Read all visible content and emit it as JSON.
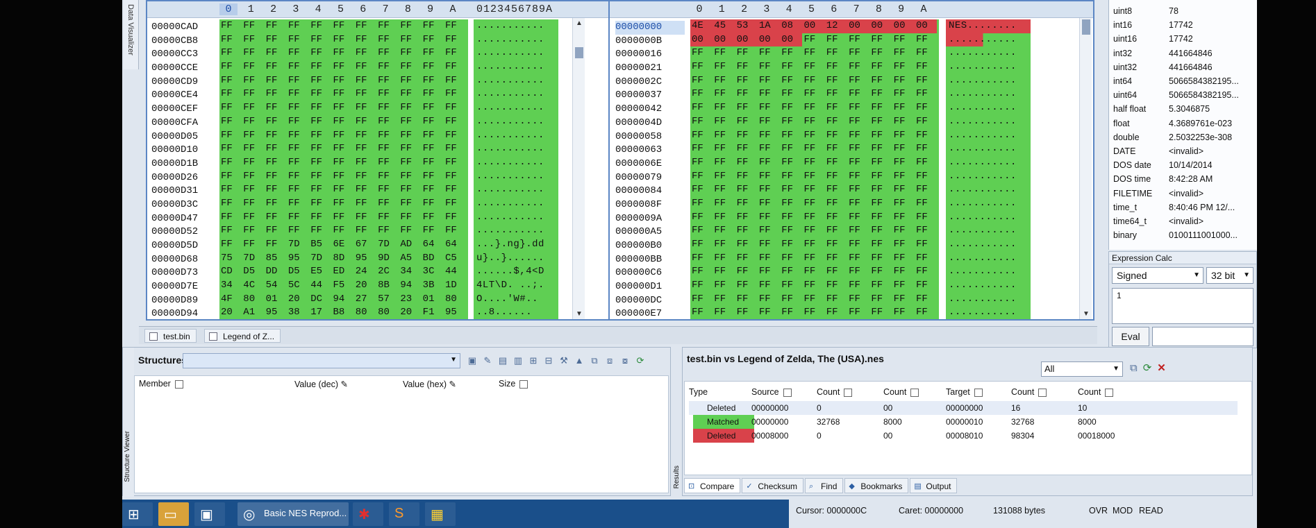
{
  "sidebar": {
    "data_visualizer_label": "Data Visualizer"
  },
  "left_pane": {
    "columns": [
      "0",
      "1",
      "2",
      "3",
      "4",
      "5",
      "6",
      "7",
      "8",
      "9",
      "A"
    ],
    "ascii_header": "0123456789A",
    "offsets": [
      "00000CAD",
      "00000CB8",
      "00000CC3",
      "00000CCE",
      "00000CD9",
      "00000CE4",
      "00000CEF",
      "00000CFA",
      "00000D05",
      "00000D10",
      "00000D1B",
      "00000D26",
      "00000D31",
      "00000D3C",
      "00000D47",
      "00000D52",
      "00000D5D",
      "00000D68",
      "00000D73",
      "00000D7E",
      "00000D89",
      "00000D94"
    ],
    "rows": [
      "FF FF FF FF FF FF FF FF FF FF FF",
      "FF FF FF FF FF FF FF FF FF FF FF",
      "FF FF FF FF FF FF FF FF FF FF FF",
      "FF FF FF FF FF FF FF FF FF FF FF",
      "FF FF FF FF FF FF FF FF FF FF FF",
      "FF FF FF FF FF FF FF FF FF FF FF",
      "FF FF FF FF FF FF FF FF FF FF FF",
      "FF FF FF FF FF FF FF FF FF FF FF",
      "FF FF FF FF FF FF FF FF FF FF FF",
      "FF FF FF FF FF FF FF FF FF FF FF",
      "FF FF FF FF FF FF FF FF FF FF FF",
      "FF FF FF FF FF FF FF FF FF FF FF",
      "FF FF FF FF FF FF FF FF FF FF FF",
      "FF FF FF FF FF FF FF FF FF FF FF",
      "FF FF FF FF FF FF FF FF FF FF FF",
      "FF FF FF FF FF FF FF FF FF FF FF",
      "FF FF FF 7D B5 6E 67 7D AD 64 64",
      "75 7D 85 95 7D 8D 95 9D A5 BD C5",
      "CD D5 DD D5 E5 ED 24 2C 34 3C 44",
      "34 4C 54 5C 44 F5 20 8B 94 3B 1D",
      "4F 80 01 20 DC 94 27 57 23 01 80",
      "20 A1 95 38 17 B8 80 80 20 F1 95"
    ],
    "ascii": [
      "...........",
      "...........",
      "...........",
      "...........",
      "...........",
      "...........",
      "...........",
      "...........",
      "...........",
      "...........",
      "...........",
      "...........",
      "...........",
      "...........",
      "...........",
      "...........",
      "...}.ng}.dd",
      "u}..}......",
      "......$,4<D",
      "4LT\\D. ..;.",
      "O....'W#..",
      "..8......"
    ]
  },
  "right_pane": {
    "columns": [
      "0",
      "1",
      "2",
      "3",
      "4",
      "5",
      "6",
      "7",
      "8",
      "9",
      "A"
    ],
    "offsets": [
      "00000000",
      "0000000B",
      "00000016",
      "00000021",
      "0000002C",
      "00000037",
      "00000042",
      "0000004D",
      "00000058",
      "00000063",
      "0000006E",
      "00000079",
      "00000084",
      "0000008F",
      "0000009A",
      "000000A5",
      "000000B0",
      "000000BB",
      "000000C6",
      "000000D1",
      "000000DC",
      "000000E7"
    ],
    "rows": [
      "4E 45 53 1A 08 00 12 00 00 00 00",
      "00 00 00 00 00 FF FF FF FF FF FF",
      "FF FF FF FF FF FF FF FF FF FF FF",
      "FF FF FF FF FF FF FF FF FF FF FF",
      "FF FF FF FF FF FF FF FF FF FF FF",
      "FF FF FF FF FF FF FF FF FF FF FF",
      "FF FF FF FF FF FF FF FF FF FF FF",
      "FF FF FF FF FF FF FF FF FF FF FF",
      "FF FF FF FF FF FF FF FF FF FF FF",
      "FF FF FF FF FF FF FF FF FF FF FF",
      "FF FF FF FF FF FF FF FF FF FF FF",
      "FF FF FF FF FF FF FF FF FF FF FF",
      "FF FF FF FF FF FF FF FF FF FF FF",
      "FF FF FF FF FF FF FF FF FF FF FF",
      "FF FF FF FF FF FF FF FF FF FF FF",
      "FF FF FF FF FF FF FF FF FF FF FF",
      "FF FF FF FF FF FF FF FF FF FF FF",
      "FF FF FF FF FF FF FF FF FF FF FF",
      "FF FF FF FF FF FF FF FF FF FF FF",
      "FF FF FF FF FF FF FF FF FF FF FF",
      "FF FF FF FF FF FF FF FF FF FF FF",
      "FF FF FF FF FF FF FF FF FF FF FF"
    ],
    "ascii": [
      "NES........",
      "...........",
      "...........",
      "...........",
      "...........",
      "...........",
      "...........",
      "...........",
      "...........",
      "...........",
      "...........",
      "...........",
      "...........",
      "...........",
      "...........",
      "...........",
      "...........",
      "...........",
      "...........",
      "...........",
      "...........",
      "..........."
    ]
  },
  "doc_tabs": [
    "test.bin",
    "Legend of Z..."
  ],
  "inspector": [
    {
      "k": "uint8",
      "v": "78"
    },
    {
      "k": "int16",
      "v": "17742"
    },
    {
      "k": "uint16",
      "v": "17742"
    },
    {
      "k": "int32",
      "v": "441664846"
    },
    {
      "k": "uint32",
      "v": "441664846"
    },
    {
      "k": "int64",
      "v": "5066584382195..."
    },
    {
      "k": "uint64",
      "v": "5066584382195..."
    },
    {
      "k": "half float",
      "v": "5.3046875"
    },
    {
      "k": "float",
      "v": "4.3689761e-023"
    },
    {
      "k": "double",
      "v": "2.5032253e-308"
    },
    {
      "k": "DATE",
      "v": "<invalid>"
    },
    {
      "k": "DOS date",
      "v": "10/14/2014"
    },
    {
      "k": "DOS time",
      "v": "8:42:28 AM"
    },
    {
      "k": "FILETIME",
      "v": "<invalid>"
    },
    {
      "k": "time_t",
      "v": "8:40:46 PM 12/..."
    },
    {
      "k": "time64_t",
      "v": "<invalid>"
    },
    {
      "k": "binary",
      "v": "0100111001000..."
    }
  ],
  "calc": {
    "title": "Expression Calc",
    "signed": "Signed",
    "bits": "32 bit",
    "expression": "1",
    "eval_label": "Eval"
  },
  "structures": {
    "title": "Structures",
    "side_label": "Structure Viewer",
    "headers": [
      "Member",
      "Value (dec)",
      "Value (hex)",
      "Size"
    ]
  },
  "compare": {
    "title": "test.bin vs Legend of Zelda, The (USA).nes",
    "side_label": "Results",
    "filter": "All",
    "headers": [
      "Type",
      "Source",
      "Count",
      "Count",
      "Target",
      "Count",
      "Count"
    ],
    "rows": [
      {
        "type": "Deleted",
        "source": "00000000",
        "count1": "0",
        "count2": "00",
        "target": "00000000",
        "count3": "16",
        "count4": "10",
        "color": ""
      },
      {
        "type": "Matched",
        "source": "00000000",
        "count1": "32768",
        "count2": "8000",
        "target": "00000010",
        "count3": "32768",
        "count4": "8000",
        "color": "#5fcf53"
      },
      {
        "type": "Deleted",
        "source": "00008000",
        "count1": "0",
        "count2": "00",
        "target": "00008010",
        "count3": "98304",
        "count4": "00018000",
        "color": "#d9424a"
      }
    ],
    "tabs": [
      "Compare",
      "Checksum",
      "Find",
      "Bookmarks",
      "Output"
    ]
  },
  "status": {
    "cursor": "Cursor: 0000000C",
    "caret": "Caret: 00000000",
    "bytes": "131088 bytes",
    "ovr": "OVR",
    "mod": "MOD",
    "read": "READ"
  },
  "taskbar": {
    "chrome_label": "Basic NES Reprod..."
  }
}
